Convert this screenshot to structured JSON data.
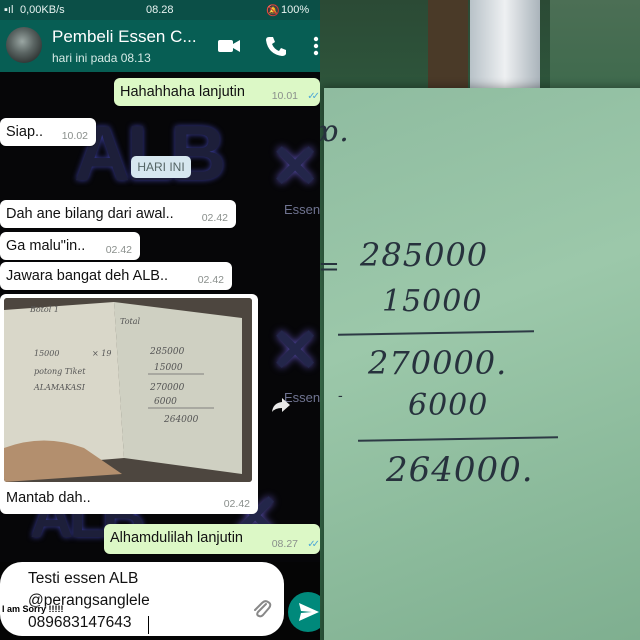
{
  "status_bar": {
    "network": "0,00KB/s",
    "time": "08.28",
    "battery": "100%"
  },
  "chat_header": {
    "title": "Pembeli Essen C...",
    "subtitle": "hari ini pada 08.13",
    "icons": [
      "avatar",
      "video-call-icon",
      "phone-icon",
      "more-icon"
    ]
  },
  "wallpaper": {
    "logo_text": "ALB",
    "watermark": "Essen"
  },
  "messages": [
    {
      "dir": "out",
      "text": "Hahahhaha lanjutin",
      "time": "10.01",
      "read": true
    },
    {
      "dir": "in",
      "text": "Siap..",
      "time": "10.02"
    },
    {
      "dir": "chip",
      "text": "HARI INI"
    },
    {
      "dir": "in",
      "text": "Dah ane bilang dari awal..",
      "time": "02.42"
    },
    {
      "dir": "in",
      "text": "Ga malu\"in..",
      "time": "02.42"
    },
    {
      "dir": "in",
      "text": "Jawara bangat deh ALB..",
      "time": "02.42"
    },
    {
      "dir": "in",
      "type": "image",
      "caption": "Mantab dah..",
      "time": "02.42"
    },
    {
      "dir": "out",
      "text": "Alhamdulilah lanjutin",
      "time": "08.27",
      "read": true
    }
  ],
  "composer": {
    "lines": [
      "Testi essen ALB",
      "@perangsanglele",
      "089683147643"
    ],
    "overlay": "I am Sorry !!!!!"
  },
  "receipt_photo": {
    "lines": [
      "285000",
      "15000",
      "270000",
      "6000",
      "264000"
    ]
  },
  "handwritten_note": {
    "lines": [
      "285000",
      "15000",
      "270000.",
      "6000",
      "264000."
    ]
  },
  "colors": {
    "header": "#075e54",
    "outgoing": "#dcf8c6",
    "incoming": "#ffffff",
    "send": "#00897b",
    "paper": "#95c2a4"
  }
}
